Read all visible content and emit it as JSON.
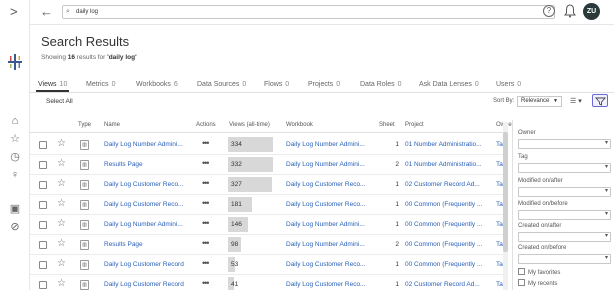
{
  "search": {
    "value": "daily log"
  },
  "user": {
    "initials": "ZU"
  },
  "page": {
    "title": "Search Results",
    "subtitle_prefix": "Showing",
    "count": "16",
    "subtitle_mid": "results for",
    "query": "'daily log'"
  },
  "tabs": [
    {
      "label": "Views",
      "count": "10"
    },
    {
      "label": "Metrics",
      "count": "0"
    },
    {
      "label": "Workbooks",
      "count": "6"
    },
    {
      "label": "Data Sources",
      "count": "0"
    },
    {
      "label": "Flows",
      "count": "0"
    },
    {
      "label": "Projects",
      "count": "0"
    },
    {
      "label": "Data Roles",
      "count": "0"
    },
    {
      "label": "Ask Data Lenses",
      "count": "0"
    },
    {
      "label": "Users",
      "count": "0"
    }
  ],
  "toolbar": {
    "select_all": "Select All",
    "sort_by": "Sort By:",
    "sort_value": "Relevance"
  },
  "columns": {
    "type": "Type",
    "name": "Name",
    "actions": "Actions",
    "views": "Views (all-time)",
    "workbook": "Workbook",
    "sheet": "Sheet",
    "project": "Project",
    "owner": "Owne"
  },
  "rows": [
    {
      "name": "Daily Log Number Admini...",
      "views": "334",
      "workbook": "Daily Log Number Admini...",
      "sheet": "1",
      "project": "01 Number Administratio...",
      "owner": "Ta"
    },
    {
      "name": "Results Page",
      "views": "332",
      "workbook": "Daily Log Number Admini...",
      "sheet": "2",
      "project": "01 Number Administratio...",
      "owner": "Ta"
    },
    {
      "name": "Daily Log Customer Reco...",
      "views": "327",
      "workbook": "Daily Log Customer Reco...",
      "sheet": "1",
      "project": "02 Customer Record Ad...",
      "owner": "Ta"
    },
    {
      "name": "Daily Log Customer Reco...",
      "views": "181",
      "workbook": "Daily Log Customer Reco...",
      "sheet": "1",
      "project": "00 Common (Frequently ...",
      "owner": "Ta"
    },
    {
      "name": "Daily Log Number Admini...",
      "views": "146",
      "workbook": "Daily Log Number Admini...",
      "sheet": "1",
      "project": "00 Common (Frequently ...",
      "owner": "Ta"
    },
    {
      "name": "Results Page",
      "views": "98",
      "workbook": "Daily Log Number Admini...",
      "sheet": "2",
      "project": "00 Common (Frequently ...",
      "owner": "Ta"
    },
    {
      "name": "Daily Log Customer Record",
      "views": "53",
      "workbook": "Daily Log Customer Reco...",
      "sheet": "1",
      "project": "00 Common (Frequently ...",
      "owner": "Ta"
    },
    {
      "name": "Daily Log Customer Record",
      "views": "41",
      "workbook": "Daily Log Customer Reco...",
      "sheet": "1",
      "project": "02 Customer Record Ad...",
      "owner": "Ta"
    }
  ],
  "filters": {
    "owner": "Owner",
    "tag": "Tag",
    "modified_after": "Modified on/after",
    "modified_before": "Modified on/before",
    "created_after": "Created on/after",
    "created_before": "Created on/before",
    "favorites": "My favorites",
    "recents": "My recents"
  }
}
